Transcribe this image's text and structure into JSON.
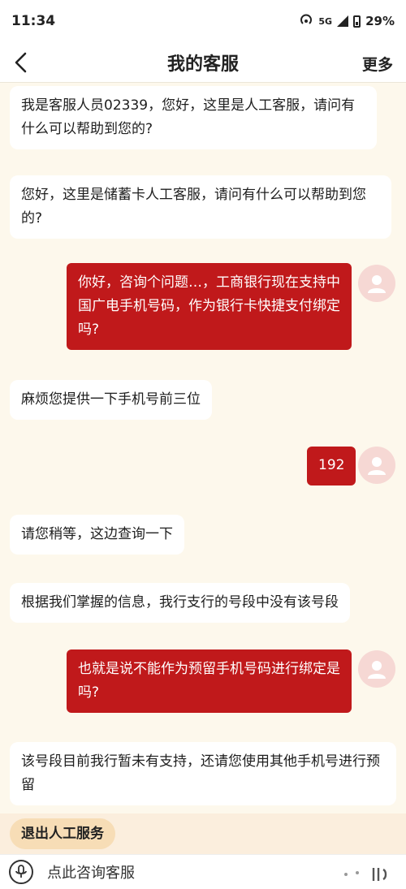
{
  "status": {
    "time": "11:34",
    "network": "5G",
    "battery": "29%"
  },
  "nav": {
    "title": "我的客服",
    "more": "更多"
  },
  "messages": [
    {
      "side": "left",
      "text": "我是客服人员02339，您好，这里是人工客服，请问有什么可以帮助到您的?"
    },
    {
      "side": "left",
      "text": "您好，这里是储蓄卡人工客服，请问有什么可以帮助到您的?"
    },
    {
      "side": "right",
      "text": "你好，咨询个问题…，工商银行现在支持中国广电手机号码，作为银行卡快捷支付绑定吗?"
    },
    {
      "side": "left",
      "text": "麻烦您提供一下手机号前三位"
    },
    {
      "side": "right",
      "text": "192"
    },
    {
      "side": "left",
      "text": "请您稍等，这边查询一下"
    },
    {
      "side": "left",
      "text": "根据我们掌握的信息，我行支行的号段中没有该号段"
    },
    {
      "side": "right",
      "text": "也就是说不能作为预留手机号码进行绑定是吗?"
    },
    {
      "side": "left",
      "text": "该号段目前我行暂未有支持，还请您使用其他手机号进行预留"
    }
  ],
  "bottom": {
    "exit_label": "退出人工服务",
    "input_placeholder": "点此咨询客服"
  }
}
